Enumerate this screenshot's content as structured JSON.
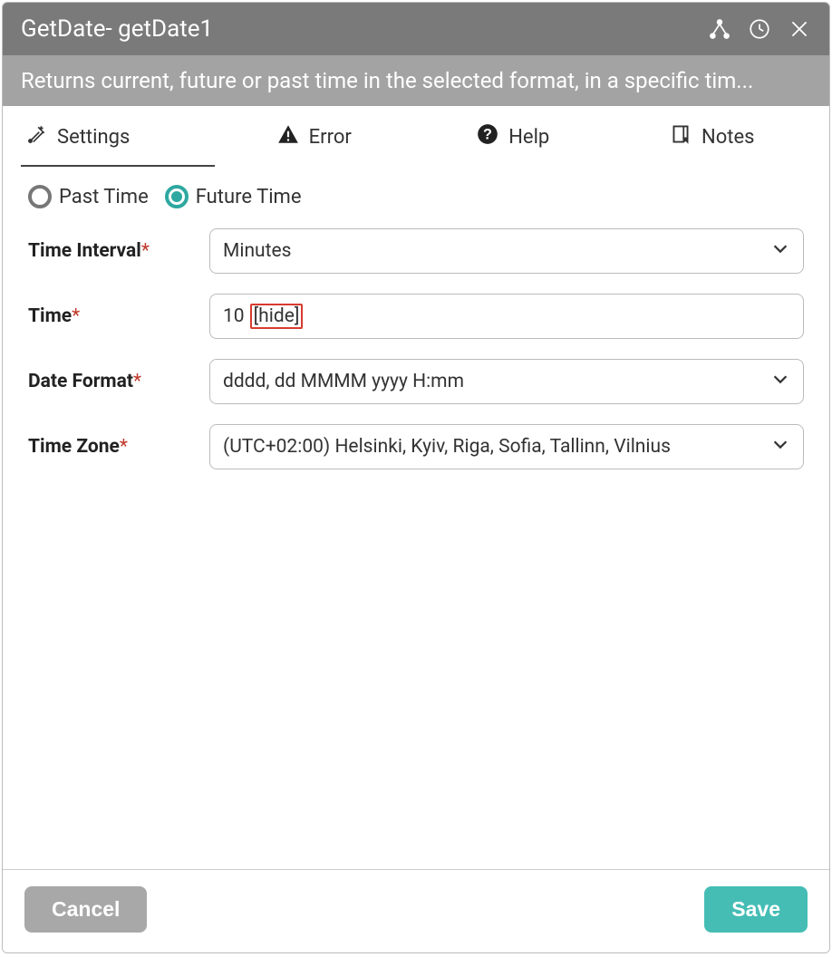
{
  "header": {
    "title": "GetDate-  getDate1",
    "description": "Returns current, future or past time in the selected format, in a specific tim..."
  },
  "tabs": {
    "settings": "Settings",
    "error": "Error",
    "help": "Help",
    "notes": "Notes"
  },
  "radios": {
    "past": "Past Time",
    "future": "Future Time"
  },
  "fields": {
    "interval": {
      "label": "Time Interval",
      "value": "Minutes"
    },
    "time": {
      "label": "Time",
      "value": "10",
      "tag": "[hide]"
    },
    "format": {
      "label": "Date Format",
      "value": "dddd, dd MMMM yyyy H:mm"
    },
    "timezone": {
      "label": "Time Zone",
      "value": "(UTC+02:00) Helsinki, Kyiv, Riga, Sofia, Tallinn, Vilnius"
    }
  },
  "footer": {
    "cancel": "Cancel",
    "save": "Save"
  }
}
